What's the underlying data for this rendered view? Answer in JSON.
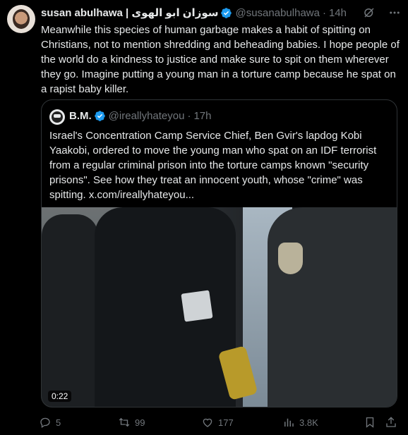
{
  "post": {
    "author_name": "susan abulhawa | سوزان ابو الهوى",
    "handle": "@susanabulhawa",
    "separator": "·",
    "time": "14h",
    "text": "Meanwhile this species of human garbage makes a habit of spitting on Christians, not to mention shredding and beheading babies. I hope people of the world do a kindness to justice and make sure to spit on them wherever they go. Imagine putting a young man in a torture camp because he spat on a rapist baby killer."
  },
  "quote": {
    "author_name": "B.M.",
    "handle": "@ireallyhateyou",
    "separator": "·",
    "time": "17h",
    "text": "Israel's Concentration Camp Service Chief, Ben Gvir's lapdog Kobi Yaakobi, ordered to move the young man who spat on an IDF terrorist from a regular criminal prison into the torture camps known \"security prisons\". See how they treat an innocent youth, whose \"crime\" was spitting.  x.com/ireallyhateyou...",
    "video_duration": "0:22"
  },
  "actions": {
    "replies": "5",
    "reposts": "99",
    "likes": "177",
    "views": "3.8K"
  },
  "icons": [
    "verified-badge-icon",
    "grok-icon",
    "more-icon",
    "reply-icon",
    "repost-icon",
    "like-icon",
    "views-icon",
    "bookmark-icon",
    "share-icon"
  ],
  "colors": {
    "background": "#000000",
    "text": "#e7e9ea",
    "muted": "#71767b",
    "verified": "#1d9bf0",
    "border": "#2f3336"
  }
}
